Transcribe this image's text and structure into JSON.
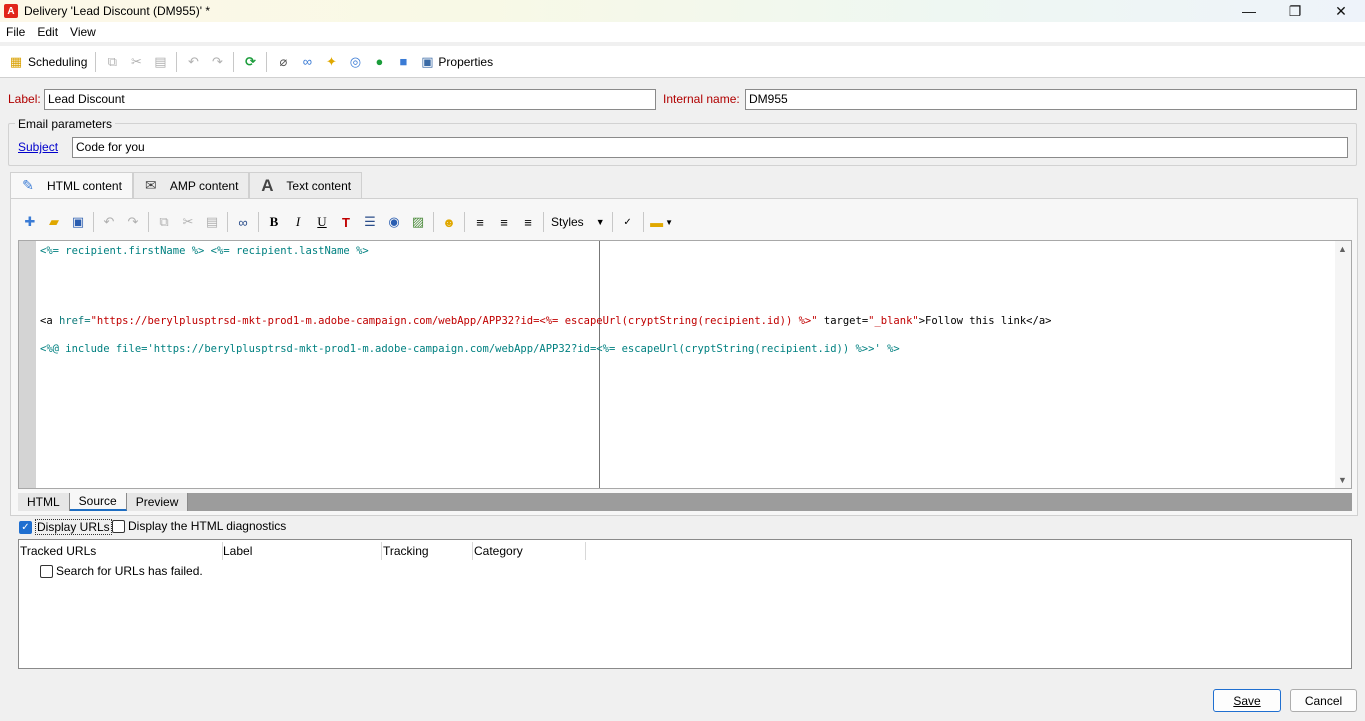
{
  "window": {
    "title": "Delivery 'Lead Discount (DM955)' *",
    "minimize": "—",
    "maximize": "❐",
    "close": "✕"
  },
  "menu": [
    "File",
    "Edit",
    "View"
  ],
  "toolbar": {
    "scheduling": "Scheduling",
    "properties": "Properties"
  },
  "form": {
    "label_caption": "Label:",
    "label_value": "Lead Discount",
    "internal_name_caption": "Internal name:",
    "internal_name_value": "DM955",
    "email_params_title": "Email parameters",
    "subject_link": "Subject",
    "subject_value": "Code for you"
  },
  "content_tabs": [
    {
      "label": "HTML content",
      "icon": "html-content-icon",
      "active": true
    },
    {
      "label": "AMP content",
      "icon": "amp-content-icon",
      "active": false
    },
    {
      "label": "Text content",
      "icon": "text-content-icon",
      "active": false
    }
  ],
  "editor": {
    "styles_label": "Styles",
    "code_lines": [
      {
        "parts": [
          [
            "tag",
            "<%= recipient.firstName %> <%= recipient.lastName %>"
          ]
        ]
      },
      {
        "parts": [
          [
            "plain",
            "<a "
          ],
          [
            "attr",
            "href="
          ],
          [
            "str",
            "\"https://berylplusptrsd-mkt-prod1-m.adobe-campaign.com/webApp/APP32?id=<%= escapeUrl(cryptString(recipient.id)) %>\""
          ],
          [
            "plain",
            " target="
          ],
          [
            "str",
            "\"_blank\""
          ],
          [
            "plain",
            ">Follow this link</a>"
          ]
        ]
      },
      {
        "parts": [
          [
            "tag",
            "<%@ include file='https://berylplusptrsd-mkt-prod1-m.adobe-campaign.com/webApp/APP32?id=<%= escapeUrl(cryptString(recipient.id)) %>>' %>"
          ]
        ]
      }
    ],
    "bottom_tabs": [
      {
        "label": "HTML",
        "active": false
      },
      {
        "label": "Source",
        "active": true
      },
      {
        "label": "Preview",
        "active": false
      }
    ]
  },
  "options": {
    "display_urls": "Display URLs",
    "display_urls_checked": true,
    "html_diagnostics": "Display the HTML diagnostics",
    "html_diagnostics_checked": false
  },
  "url_table": {
    "columns": [
      "Tracked URLs",
      "Label",
      "Tracking",
      "Category"
    ],
    "message": "Search for URLs has failed."
  },
  "buttons": {
    "save": "Save",
    "cancel": "Cancel"
  },
  "colors": {
    "accent": "#1f6fd0",
    "required_label": "#b00000",
    "code_tag": "#008080",
    "code_string": "#c00000"
  }
}
